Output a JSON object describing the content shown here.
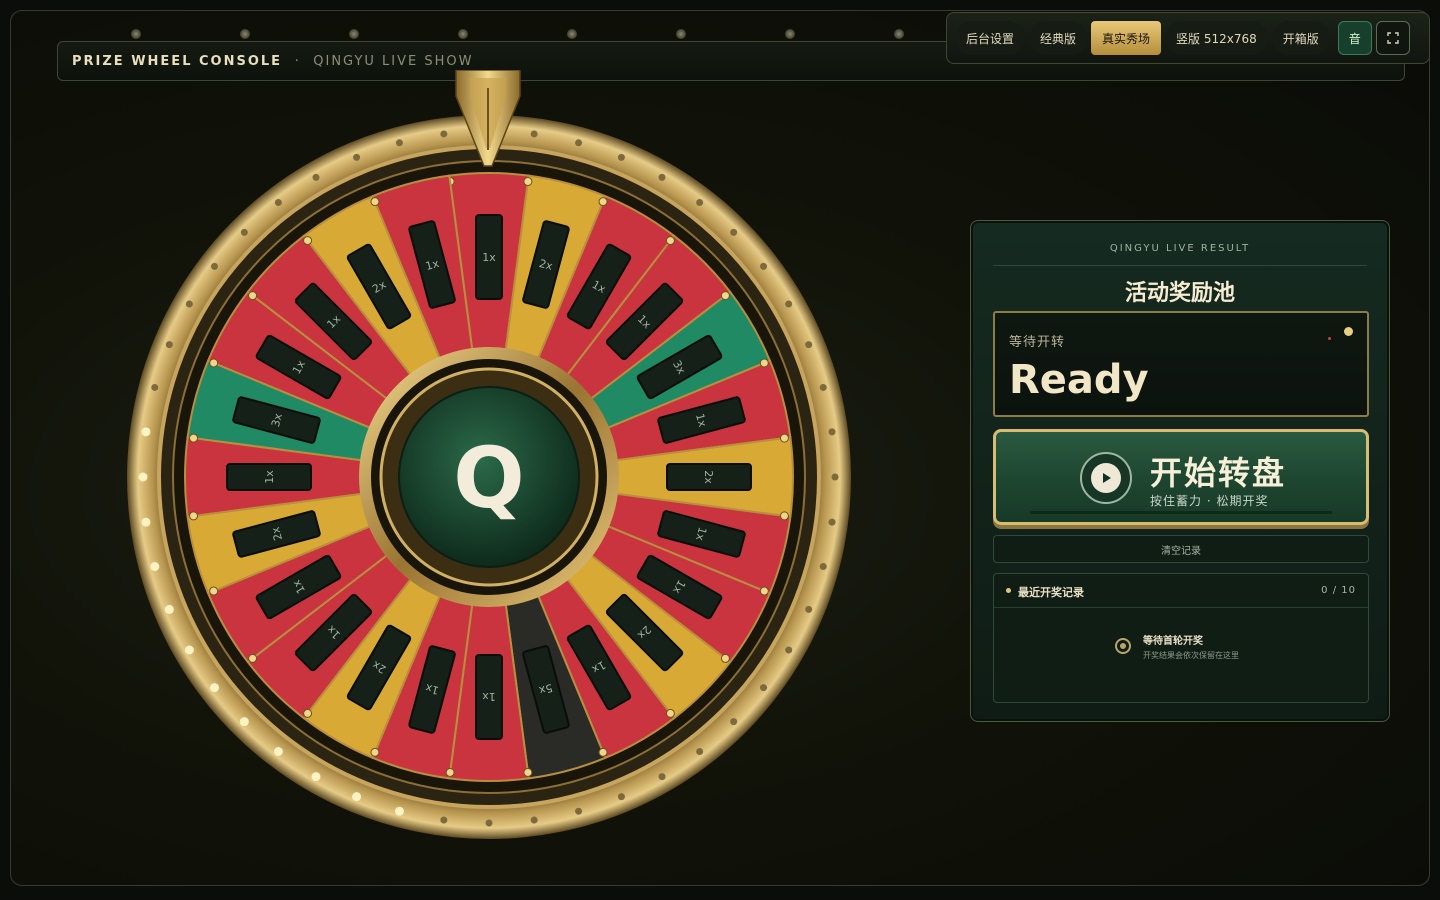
{
  "header": {
    "title": "PRIZE WHEEL CONSOLE",
    "separator": "·",
    "subtitle": "QINGYU LIVE SHOW"
  },
  "toolbar": {
    "buttons": [
      {
        "label": "后台设置",
        "active": false
      },
      {
        "label": "经典版",
        "active": false
      },
      {
        "label": "真实秀场",
        "active": true
      },
      {
        "label": "竖版 512x768",
        "active": false
      },
      {
        "label": "开箱版",
        "active": false
      }
    ],
    "sound_label": "音",
    "fullscreen_icon": "fullscreen-icon"
  },
  "wheel": {
    "center_logo": "Q",
    "segments": [
      {
        "label": "1x",
        "color": "#c9343e"
      },
      {
        "label": "2x",
        "color": "#d9a935"
      },
      {
        "label": "1x",
        "color": "#c9343e"
      },
      {
        "label": "1x",
        "color": "#c9343e"
      },
      {
        "label": "3x",
        "color": "#1f8a63"
      },
      {
        "label": "1x",
        "color": "#c9343e"
      },
      {
        "label": "2x",
        "color": "#d9a935"
      },
      {
        "label": "1x",
        "color": "#c9343e"
      },
      {
        "label": "1x",
        "color": "#c9343e"
      },
      {
        "label": "2x",
        "color": "#d9a935"
      },
      {
        "label": "1x",
        "color": "#c9343e"
      },
      {
        "label": "5x",
        "color": "#2a2a26"
      },
      {
        "label": "1x",
        "color": "#c9343e"
      },
      {
        "label": "1x",
        "color": "#c9343e"
      },
      {
        "label": "2x",
        "color": "#d9a935"
      },
      {
        "label": "1x",
        "color": "#c9343e"
      },
      {
        "label": "1x",
        "color": "#c9343e"
      },
      {
        "label": "2x",
        "color": "#d9a935"
      },
      {
        "label": "1x",
        "color": "#c9343e"
      },
      {
        "label": "3x",
        "color": "#1f8a63"
      },
      {
        "label": "1x",
        "color": "#c9343e"
      },
      {
        "label": "1x",
        "color": "#c9343e"
      },
      {
        "label": "2x",
        "color": "#d9a935"
      },
      {
        "label": "1x",
        "color": "#c9343e"
      }
    ]
  },
  "result_panel": {
    "eyebrow": "QINGYU LIVE RESULT",
    "title": "活动奖励池",
    "status_label": "等待开转",
    "status_value": "Ready",
    "spin_button": {
      "label": "开始转盘",
      "hint": "按住蓄力 · 松期开奖",
      "icon": "play-icon"
    },
    "clear_button": "清空记录",
    "history": {
      "title": "最近开奖记录",
      "count": "0 / 10",
      "empty_title": "等待首轮开奖",
      "empty_subtitle": "开奖结果会依次保留在这里"
    }
  },
  "colors": {
    "accent_gold": "#d7bd72",
    "panel_green": "#1d4530",
    "background": "#0b0d0a"
  }
}
